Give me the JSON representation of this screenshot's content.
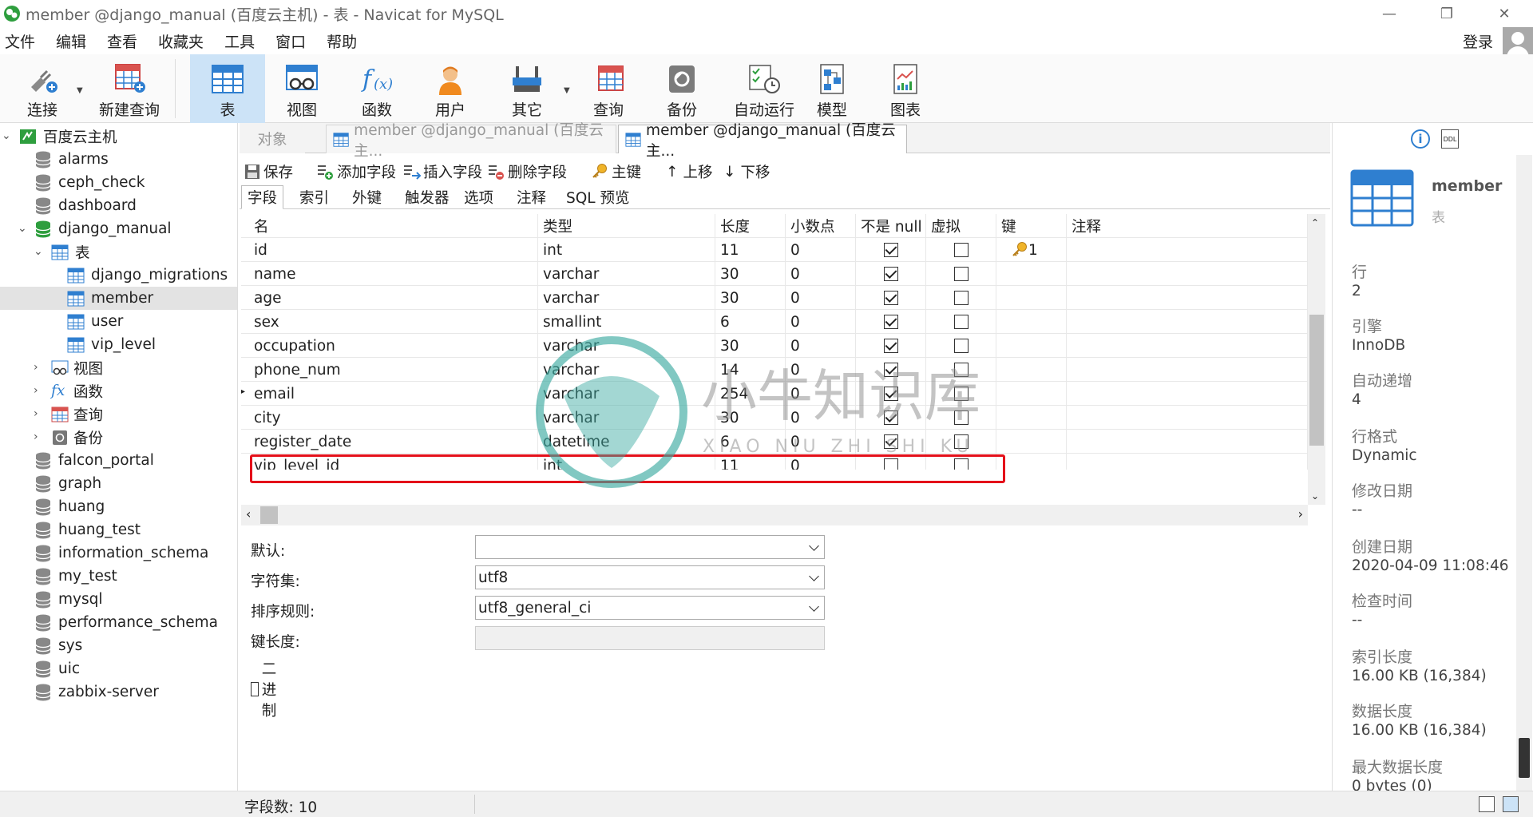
{
  "window": {
    "title": "member @django_manual (百度云主机) - 表 - Navicat for MySQL"
  },
  "menu": [
    "文件",
    "编辑",
    "查看",
    "收藏夹",
    "工具",
    "窗口",
    "帮助"
  ],
  "login_label": "登录",
  "toolbar": {
    "connect": "连接",
    "new_query": "新建查询",
    "table": "表",
    "view": "视图",
    "function": "函数",
    "user": "用户",
    "other": "其它",
    "query": "查询",
    "backup": "备份",
    "auto_run": "自动运行",
    "model": "模型",
    "chart": "图表"
  },
  "tree": {
    "root": "百度云主机",
    "dbs_top": [
      "alarms",
      "ceph_check",
      "dashboard"
    ],
    "open_db": "django_manual",
    "tables_group": "表",
    "tables": [
      "django_migrations",
      "member",
      "user",
      "vip_level"
    ],
    "groups": [
      "视图",
      "函数",
      "查询",
      "备份"
    ],
    "dbs_bottom": [
      "falcon_portal",
      "graph",
      "huang",
      "huang_test",
      "information_schema",
      "my_test",
      "mysql",
      "performance_schema",
      "sys",
      "uic",
      "zabbix-server"
    ]
  },
  "tabs": {
    "objects": "对象",
    "tab1": "member @django_manual (百度云主...",
    "tab2": "member @django_manual (百度云主..."
  },
  "design_toolbar": {
    "save": "保存",
    "add_field": "添加字段",
    "insert_field": "插入字段",
    "delete_field": "删除字段",
    "primary_key": "主键",
    "move_up": "上移",
    "move_down": "下移"
  },
  "field_tabs": [
    "字段",
    "索引",
    "外键",
    "触发器",
    "选项",
    "注释",
    "SQL 预览"
  ],
  "columns": {
    "name": "名",
    "type": "类型",
    "length": "长度",
    "decimals": "小数点",
    "not_null": "不是 null",
    "virtual": "虚拟",
    "key": "键",
    "comment": "注释"
  },
  "fields": [
    {
      "name": "id",
      "type": "int",
      "length": "11",
      "decimals": "0",
      "not_null": true,
      "virtual": false,
      "key": "1"
    },
    {
      "name": "name",
      "type": "varchar",
      "length": "30",
      "decimals": "0",
      "not_null": true,
      "virtual": false,
      "key": ""
    },
    {
      "name": "age",
      "type": "varchar",
      "length": "30",
      "decimals": "0",
      "not_null": true,
      "virtual": false,
      "key": ""
    },
    {
      "name": "sex",
      "type": "smallint",
      "length": "6",
      "decimals": "0",
      "not_null": true,
      "virtual": false,
      "key": ""
    },
    {
      "name": "occupation",
      "type": "varchar",
      "length": "30",
      "decimals": "0",
      "not_null": true,
      "virtual": false,
      "key": ""
    },
    {
      "name": "phone_num",
      "type": "varchar",
      "length": "14",
      "decimals": "0",
      "not_null": true,
      "virtual": false,
      "key": ""
    },
    {
      "name": "email",
      "type": "varchar",
      "length": "254",
      "decimals": "0",
      "not_null": true,
      "virtual": false,
      "key": "",
      "current": true
    },
    {
      "name": "city",
      "type": "varchar",
      "length": "30",
      "decimals": "0",
      "not_null": true,
      "virtual": false,
      "key": ""
    },
    {
      "name": "register_date",
      "type": "datetime",
      "length": "6",
      "decimals": "0",
      "not_null": true,
      "virtual": false,
      "key": ""
    },
    {
      "name": "vip_level_id",
      "type": "int",
      "length": "11",
      "decimals": "0",
      "not_null": false,
      "virtual": false,
      "key": "",
      "highlighted": true
    }
  ],
  "props": {
    "default_label": "默认:",
    "default_value": "",
    "charset_label": "字符集:",
    "charset_value": "utf8",
    "collation_label": "排序规则:",
    "collation_value": "utf8_general_ci",
    "keylen_label": "键长度:",
    "binary_label": "二进制"
  },
  "info": {
    "name": "member",
    "kind": "表",
    "rows_label": "行",
    "rows": "2",
    "engine_label": "引擎",
    "engine": "InnoDB",
    "auto_inc_label": "自动递增",
    "auto_inc": "4",
    "row_format_label": "行格式",
    "row_format": "Dynamic",
    "modified_label": "修改日期",
    "modified": "--",
    "created_label": "创建日期",
    "created": "2020-04-09 11:08:46",
    "checked_label": "检查时间",
    "checked": "--",
    "index_len_label": "索引长度",
    "index_len": "16.00 KB (16,384)",
    "data_len_label": "数据长度",
    "data_len": "16.00 KB (16,384)",
    "max_data_len_label": "最大数据长度",
    "max_data_len": "0 bytes (0)"
  },
  "status": {
    "field_count": "字段数: 10"
  },
  "watermark": {
    "cn": "小牛知识库",
    "pinyin": "XIAO NIU ZHI SHI KU"
  },
  "colors": {
    "accent": "#cce3f7",
    "highlight": "#e4101a",
    "db_green": "#2e9e3e",
    "table_blue": "#2f7fd0"
  }
}
